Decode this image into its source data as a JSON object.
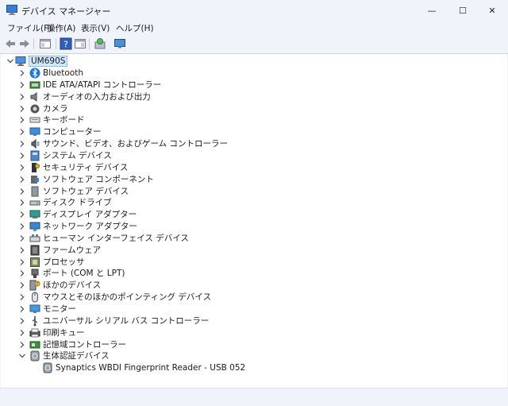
{
  "window": {
    "title": "デバイス マネージャー"
  },
  "controls": {
    "minimize": "—",
    "maximize": "☐",
    "close": "✕"
  },
  "menu": [
    "ファイル(F)",
    "操作(A)",
    "表示(V)",
    "ヘルプ(H)"
  ],
  "tree": {
    "root": "UM690S",
    "items": [
      {
        "label": "Bluetooth",
        "icon": "bluetooth-icon"
      },
      {
        "label": "IDE ATA/ATAPI コントローラー",
        "icon": "ide-controller-icon"
      },
      {
        "label": "オーディオの入力および出力",
        "icon": "audio-io-icon"
      },
      {
        "label": "カメラ",
        "icon": "camera-icon"
      },
      {
        "label": "キーボード",
        "icon": "keyboard-icon"
      },
      {
        "label": "コンピューター",
        "icon": "computer-icon"
      },
      {
        "label": "サウンド、ビデオ、およびゲーム コントローラー",
        "icon": "sound-icon"
      },
      {
        "label": "システム デバイス",
        "icon": "system-device-icon"
      },
      {
        "label": "セキュリティ デバイス",
        "icon": "security-device-icon"
      },
      {
        "label": "ソフトウェア コンポーネント",
        "icon": "software-component-icon"
      },
      {
        "label": "ソフトウェア デバイス",
        "icon": "software-device-icon"
      },
      {
        "label": "ディスク ドライブ",
        "icon": "disk-drive-icon"
      },
      {
        "label": "ディスプレイ アダプター",
        "icon": "display-adapter-icon"
      },
      {
        "label": "ネットワーク アダプター",
        "icon": "network-adapter-icon"
      },
      {
        "label": "ヒューマン インターフェイス デバイス",
        "icon": "hid-icon"
      },
      {
        "label": "ファームウェア",
        "icon": "firmware-icon"
      },
      {
        "label": "プロセッサ",
        "icon": "processor-icon"
      },
      {
        "label": "ポート (COM と LPT)",
        "icon": "port-icon"
      },
      {
        "label": "ほかのデバイス",
        "icon": "other-device-icon"
      },
      {
        "label": "マウスとそのほかのポインティング デバイス",
        "icon": "mouse-icon"
      },
      {
        "label": "モニター",
        "icon": "monitor-icon"
      },
      {
        "label": "ユニバーサル シリアル バス コントローラー",
        "icon": "usb-icon"
      },
      {
        "label": "印刷キュー",
        "icon": "printer-icon"
      },
      {
        "label": "記憶域コントローラー",
        "icon": "storage-controller-icon"
      },
      {
        "label": "生体認証デバイス",
        "icon": "biometric-icon",
        "expanded": true
      }
    ],
    "child": {
      "label": "Synaptics WBDI Fingerprint Reader - USB 052",
      "icon": "fingerprint-icon"
    }
  }
}
